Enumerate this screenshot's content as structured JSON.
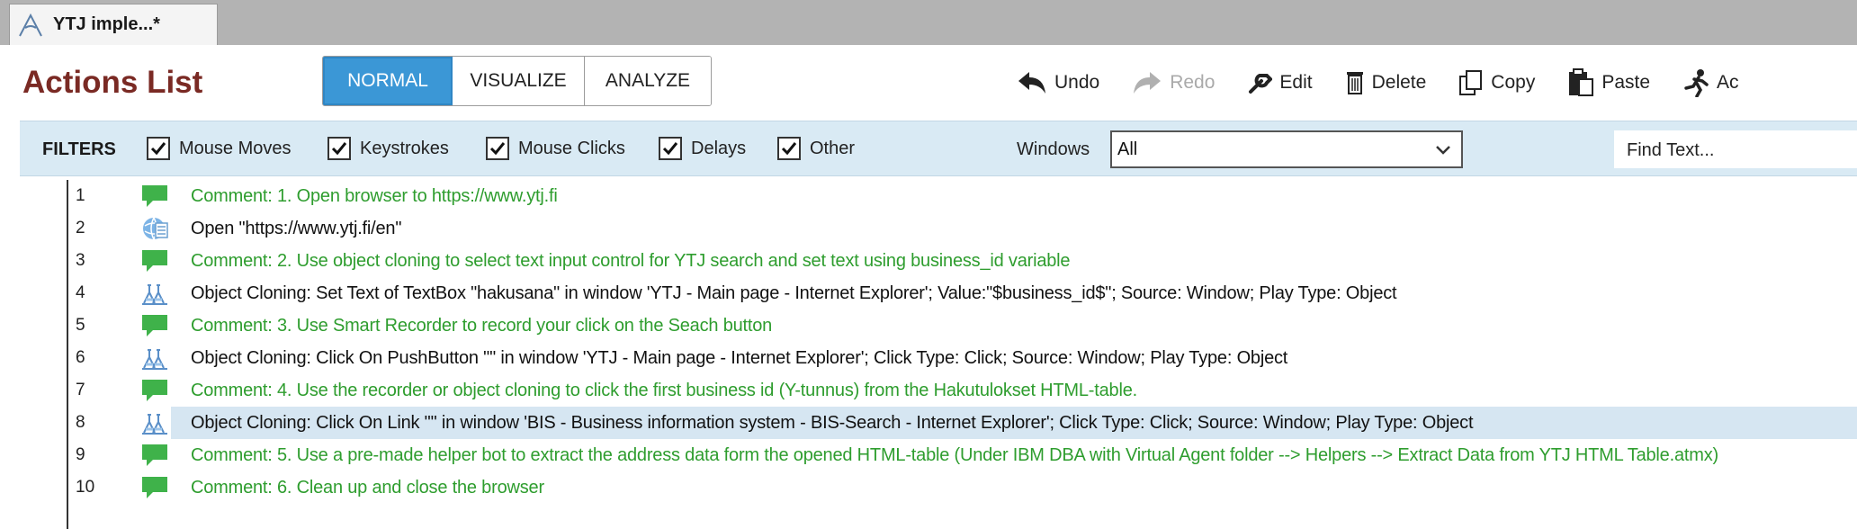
{
  "tab": {
    "title": "YTJ imple...*"
  },
  "header": {
    "title": "Actions List"
  },
  "modes": [
    {
      "label": "NORMAL",
      "active": true
    },
    {
      "label": "VISUALIZE",
      "active": false
    },
    {
      "label": "ANALYZE",
      "active": false
    }
  ],
  "toolbar": {
    "undo": "Undo",
    "redo": "Redo",
    "edit": "Edit",
    "delete": "Delete",
    "copy": "Copy",
    "paste": "Paste",
    "ac": "Ac"
  },
  "filters": {
    "label": "FILTERS",
    "items": [
      {
        "label": "Mouse Moves",
        "checked": true
      },
      {
        "label": "Keystrokes",
        "checked": true
      },
      {
        "label": "Mouse Clicks",
        "checked": true
      },
      {
        "label": "Delays",
        "checked": true
      },
      {
        "label": "Other",
        "checked": true
      }
    ],
    "windows_label": "Windows",
    "windows_value": "All",
    "find_placeholder": "Find Text..."
  },
  "colors": {
    "title": "#7a2a24",
    "accent": "#3b97d6",
    "comment": "#2e9d2e",
    "selection": "#d6e6f2",
    "filterbar": "#d9eaf4"
  },
  "actions": [
    {
      "num": "1",
      "type": "comment",
      "icon": "comment-icon",
      "text": "Comment: 1. Open browser to https://www.ytj.fi"
    },
    {
      "num": "2",
      "type": "open",
      "icon": "open-browser-icon",
      "text": "Open \"https://www.ytj.fi/en\""
    },
    {
      "num": "3",
      "type": "comment",
      "icon": "comment-icon",
      "text": "Comment: 2. Use object cloning to select text input control for YTJ search and set text using business_id variable"
    },
    {
      "num": "4",
      "type": "clone",
      "icon": "object-cloning-icon",
      "text": "Object Cloning: Set Text of TextBox \"hakusana\" in window 'YTJ - Main page - Internet Explorer'; Value:\"$business_id$\"; Source: Window; Play Type: Object"
    },
    {
      "num": "5",
      "type": "comment",
      "icon": "comment-icon",
      "text": "Comment: 3. Use Smart Recorder to record your click on the Seach button"
    },
    {
      "num": "6",
      "type": "clone",
      "icon": "object-cloning-icon",
      "text": "Object Cloning: Click On PushButton \"\" in window 'YTJ - Main page - Internet Explorer'; Click Type: Click; Source: Window; Play Type: Object"
    },
    {
      "num": "7",
      "type": "comment",
      "icon": "comment-icon",
      "text": "Comment: 4. Use the recorder or object cloning to click the first business id (Y-tunnus) from the Hakutulokset HTML-table."
    },
    {
      "num": "8",
      "type": "clone",
      "icon": "object-cloning-icon",
      "selected": true,
      "text": "Object Cloning: Click On Link \"\" in window 'BIS - Business information system - BIS-Search - Internet Explorer'; Click Type: Click; Source: Window; Play Type: Object"
    },
    {
      "num": "9",
      "type": "comment",
      "icon": "comment-icon",
      "text": "Comment: 5. Use a pre-made helper bot to extract the address data form the opened HTML-table (Under IBM DBA with Virtual Agent folder --> Helpers --> Extract Data from YTJ HTML Table.atmx)"
    },
    {
      "num": "10",
      "type": "comment",
      "icon": "comment-icon",
      "text": "Comment: 6. Clean up and close the browser"
    }
  ]
}
